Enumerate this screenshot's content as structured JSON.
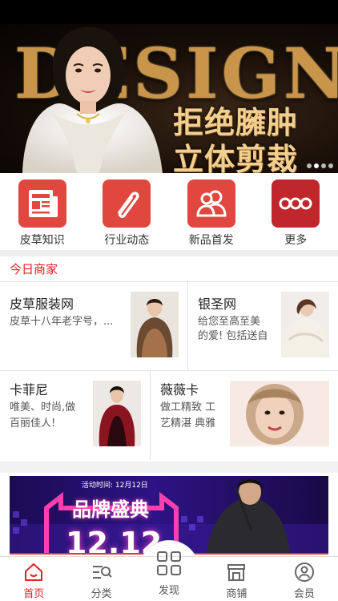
{
  "banner": {
    "headline": "DESIGN",
    "slogan_line1": "拒绝臃肿",
    "slogan_line2": "立体剪裁",
    "dots": 4,
    "active_dot": 1
  },
  "quick_nav": [
    {
      "label": "皮草知识",
      "icon": "newspaper-icon"
    },
    {
      "label": "行业动态",
      "icon": "paperclip-icon"
    },
    {
      "label": "新品首发",
      "icon": "people-icon"
    },
    {
      "label": "更多",
      "icon": "more-dots-icon"
    }
  ],
  "merchants": {
    "heading": "今日商家",
    "items": [
      {
        "name": "皮草服装网",
        "desc": "皮草十八年老字号，..."
      },
      {
        "name": "银圣网",
        "desc_line1": "给您至高至美",
        "desc_line2": "的爱! 包括送自"
      },
      {
        "name": "卡菲尼",
        "desc_line1": "唯美、时尚,做",
        "desc_line2": "百丽佳人!"
      },
      {
        "name": "薇薇卡",
        "desc_line1": "做工精致 工",
        "desc_line2": "艺精湛 典雅"
      }
    ]
  },
  "promo": {
    "event_text": "活动时间: 12月12日",
    "brand_text": "品牌盛典",
    "big_text": "12.12"
  },
  "tabbar": [
    {
      "label": "首页",
      "icon": "home-icon",
      "active": true
    },
    {
      "label": "分类",
      "icon": "category-search-icon"
    },
    {
      "label": "发现",
      "icon": "grid-icon"
    },
    {
      "label": "商铺",
      "icon": "shop-icon"
    },
    {
      "label": "会员",
      "icon": "user-icon"
    }
  ],
  "colors": {
    "accent": "#d22222",
    "icon_red": "#e0483f",
    "icon_dark_red": "#c0272d"
  }
}
